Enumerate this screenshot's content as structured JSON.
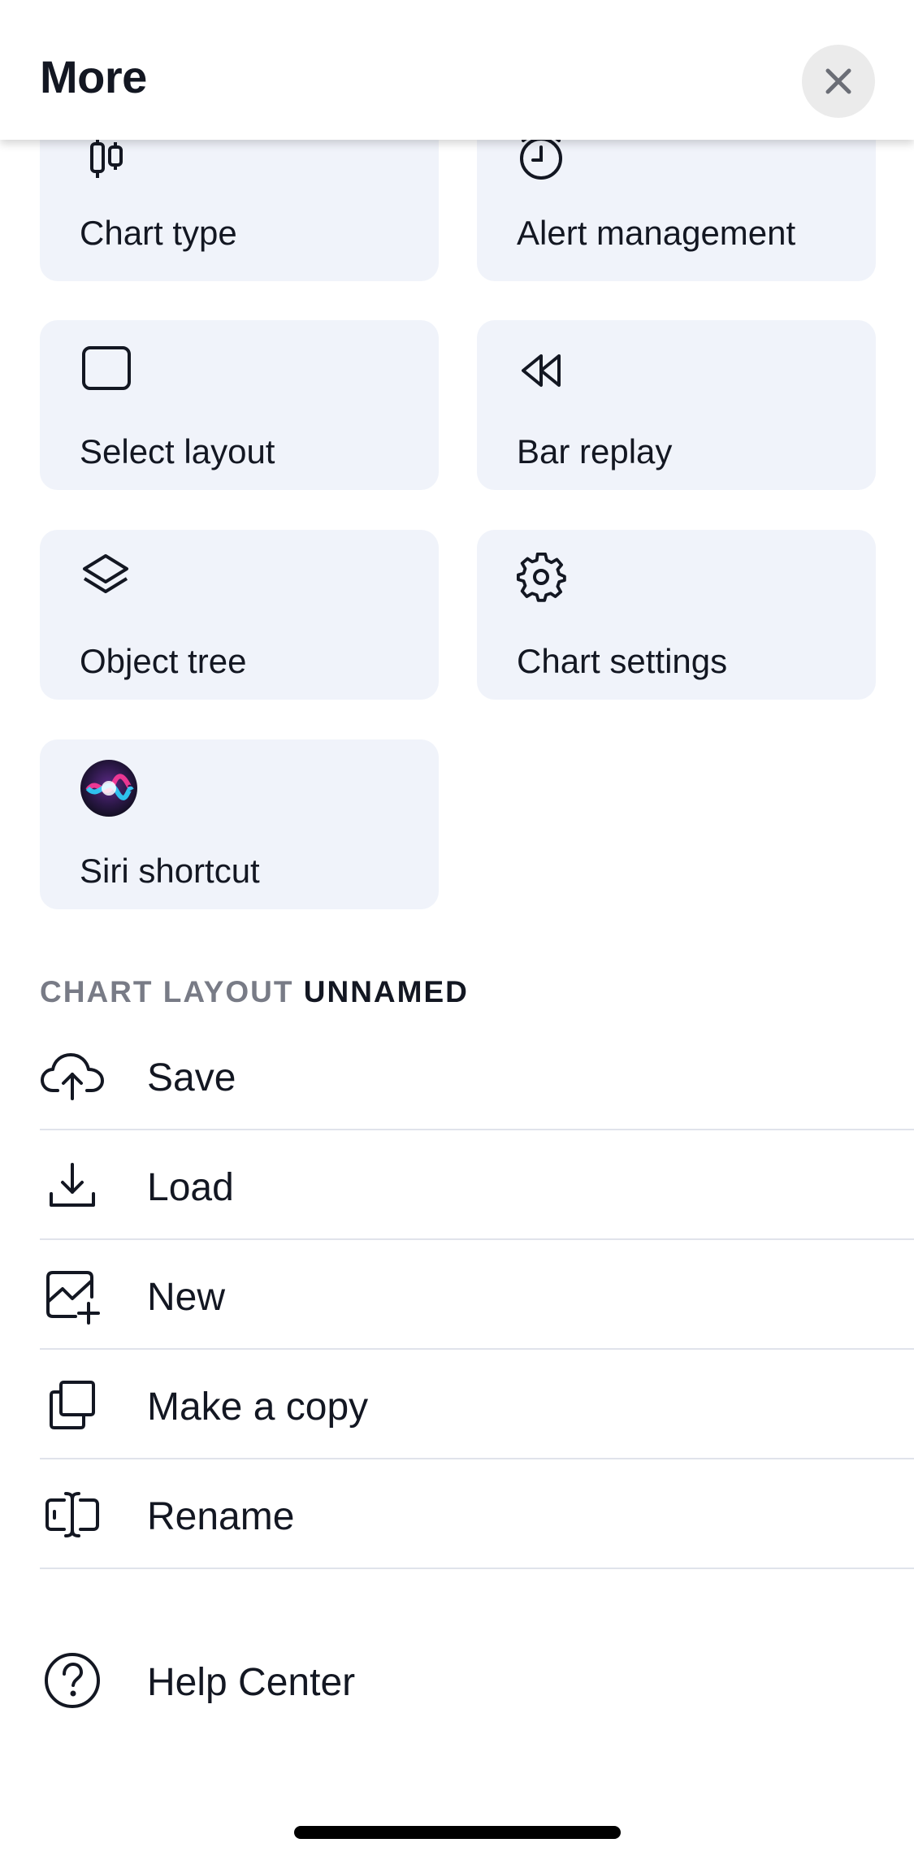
{
  "header": {
    "title": "More"
  },
  "tiles": [
    {
      "label": "Chart type",
      "icon": "candlestick-icon"
    },
    {
      "label": "Alert management",
      "icon": "alarm-clock-icon"
    },
    {
      "label": "Select layout",
      "icon": "layout-square-icon"
    },
    {
      "label": "Bar replay",
      "icon": "rewind-icon"
    },
    {
      "label": "Object tree",
      "icon": "layers-icon"
    },
    {
      "label": "Chart settings",
      "icon": "gear-icon"
    },
    {
      "label": "Siri shortcut",
      "icon": "siri-icon"
    }
  ],
  "section": {
    "prefix": "CHART LAYOUT",
    "name": "UNNAMED"
  },
  "list": [
    {
      "label": "Save",
      "icon": "cloud-upload-icon"
    },
    {
      "label": "Load",
      "icon": "download-icon"
    },
    {
      "label": "New",
      "icon": "new-chart-icon"
    },
    {
      "label": "Make a copy",
      "icon": "copy-icon"
    },
    {
      "label": "Rename",
      "icon": "rename-icon"
    }
  ],
  "help": {
    "label": "Help Center",
    "icon": "question-circle-icon"
  }
}
